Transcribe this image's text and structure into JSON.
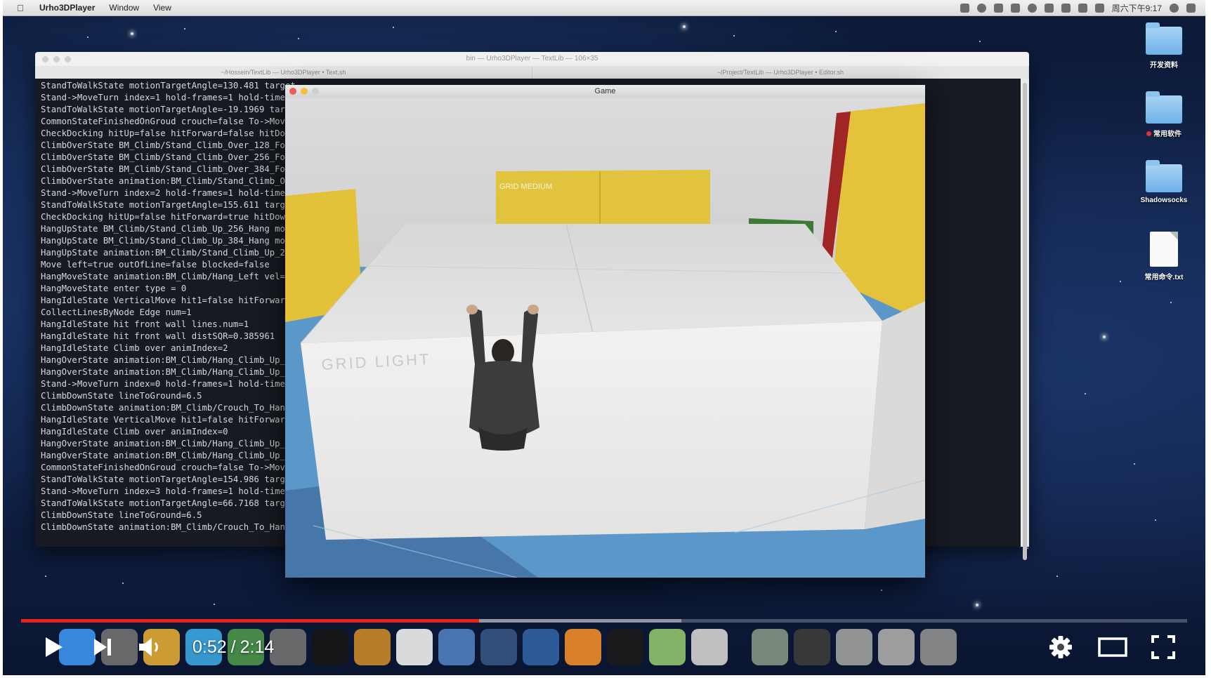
{
  "menubar": {
    "app_name": "Urho3DPlayer",
    "menus": [
      "Window",
      "View"
    ],
    "clock": "周六下午9:17",
    "icons": [
      "apple-icon",
      "notification-icon",
      "wifi-icon",
      "volume-icon",
      "search-icon",
      "list-icon"
    ]
  },
  "desktop": {
    "icons": [
      {
        "label": "开发资料",
        "kind": "folder"
      },
      {
        "label": "常用软件",
        "kind": "folder",
        "tag_color": "#e03030"
      },
      {
        "label": "Shadowsocks",
        "kind": "folder"
      },
      {
        "label": "常用命令.txt",
        "kind": "document"
      }
    ]
  },
  "terminal": {
    "title": "bin — Urho3DPlayer — TextLib — 106×35",
    "tabs": [
      "~/Hossein/TextLib — Urho3DPlayer • Text.sh",
      "~/Project/TextLib — Urho3DPlayer • Editor.sh"
    ],
    "lines": [
      "StandToWalkState motionTargetAngle=130.481 target",
      "Stand->MoveTurn index=1 hold-frames=1 hold-time",
      "StandToWalkState motionTargetAngle=-19.1969 targe",
      "CommonStateFinishedOnGroud crouch=false To->MoveT",
      "CheckDocking hitUp=false hitForward=false hitDow",
      "ClimbOverState BM_Climb/Stand_Climb_Over_128_Fol",
      "ClimbOverState BM_Climb/Stand_Climb_Over_256_Fol",
      "ClimbOverState BM_Climb/Stand_Climb_Over_384_Fol",
      "ClimbOverState animation:BM_Climb/Stand_Climb_Ov",
      "Stand->MoveTurn index=2 hold-frames=1 hold-time",
      "StandToWalkState motionTargetAngle=155.611 target",
      "CheckDocking hitUp=false hitForward=true hitDown",
      "HangUpState BM_Climb/Stand_Climb_Up_256_Hang mot",
      "HangUpState BM_Climb/Stand_Climb_Up_384_Hang mot",
      "HangUpState animation:BM_Climb/Stand_Climb_Up_25",
      "Move left=true outOfLine=false blocked=false",
      "HangMoveState animation:BM_Climb/Hang_Left vel=-",
      "HangMoveState enter type = 0",
      "HangIdleState VerticalMove hit1=false hitForward",
      "CollectLinesByNode Edge num=1",
      "HangIdleState hit front wall lines.num=1",
      "HangIdleState hit front wall distSQR=0.385961",
      "HangIdleState Climb over animIndex=2",
      "HangOverState animation:BM_Climb/Hang_Climb_Up_O",
      "HangOverState animation:BM_Climb/Hang_Climb_Up_O",
      "Stand->MoveTurn index=0 hold-frames=1 hold-time",
      "ClimbDownState lineToGround=6.5",
      "ClimbDownState animation:BM_Climb/Crouch_To_Hang",
      "HangIdleState VerticalMove hit1=false hitForward",
      "HangIdleState Climb over animIndex=0",
      "HangOverState animation:BM_Climb/Hang_Climb_Up_R",
      "HangOverState animation:BM_Climb/Hang_Climb_Up_R",
      "CommonStateFinishedOnGroud crouch=false To->MoveT",
      "StandToWalkState motionTargetAngle=154.986 target",
      "Stand->MoveTurn index=3 hold-frames=1 hold-time",
      "StandToWalkState motionTargetAngle=66.7168 target",
      "ClimbDownState lineToGround=6.5",
      "ClimbDownState animation:BM_Climb/Crouch_To_Hang"
    ]
  },
  "game_window": {
    "title": "Game",
    "scene": {
      "box_label": "GRID LIGHT",
      "wall_label": "GRID MEDIUM",
      "colors": {
        "sky": "#c8c8ca",
        "box": "#e9e8e6",
        "wall": "#e3c23a",
        "floor": "#6aa5d3",
        "green": "#3d7a33",
        "red": "#a02626"
      }
    }
  },
  "player": {
    "current_time": "0:52",
    "separator": "/",
    "duration": "2:14",
    "played_fraction": 0.393,
    "buffered_fraction": 0.566,
    "accent_color": "#e8231e",
    "buttons": [
      {
        "name": "play-button",
        "icon": "play-icon"
      },
      {
        "name": "next-button",
        "icon": "next-icon"
      },
      {
        "name": "volume-button",
        "icon": "volume-icon"
      },
      {
        "name": "settings-button",
        "icon": "gear-icon"
      },
      {
        "name": "theater-mode-button",
        "icon": "theater-icon"
      },
      {
        "name": "fullscreen-button",
        "icon": "fullscreen-icon"
      }
    ]
  },
  "dock": {
    "apps": [
      {
        "name": "finder",
        "color": "#3a8ee6"
      },
      {
        "name": "launchpad",
        "color": "#6d6d6d"
      },
      {
        "name": "chrome",
        "color": "#d8a334"
      },
      {
        "name": "telegram",
        "color": "#3aa0d8"
      },
      {
        "name": "fontlab",
        "color": "#4a8f4a"
      },
      {
        "name": "system-preferences",
        "color": "#6e6e6e"
      },
      {
        "name": "terminal",
        "color": "#151515"
      },
      {
        "name": "sublime-text",
        "color": "#c1832a"
      },
      {
        "name": "qq",
        "color": "#e5e5e5"
      },
      {
        "name": "xcode",
        "color": "#4c7ab8"
      },
      {
        "name": "sourcetree",
        "color": "#35517d"
      },
      {
        "name": "quicktime",
        "color": "#2f5f9e"
      },
      {
        "name": "blender",
        "color": "#e6862a"
      },
      {
        "name": "console",
        "color": "#1b1b1b"
      },
      {
        "name": "maps",
        "color": "#8bbc6a"
      },
      {
        "name": "preview",
        "color": "#c9c9c9"
      },
      {
        "name": "window-1",
        "color": "#7f8f7f"
      },
      {
        "name": "window-2",
        "color": "#3a3a3a"
      },
      {
        "name": "window-3",
        "color": "#9a9a9a"
      },
      {
        "name": "window-4",
        "color": "#a5a5a5"
      },
      {
        "name": "window-5",
        "color": "#8a8a8a"
      }
    ]
  }
}
